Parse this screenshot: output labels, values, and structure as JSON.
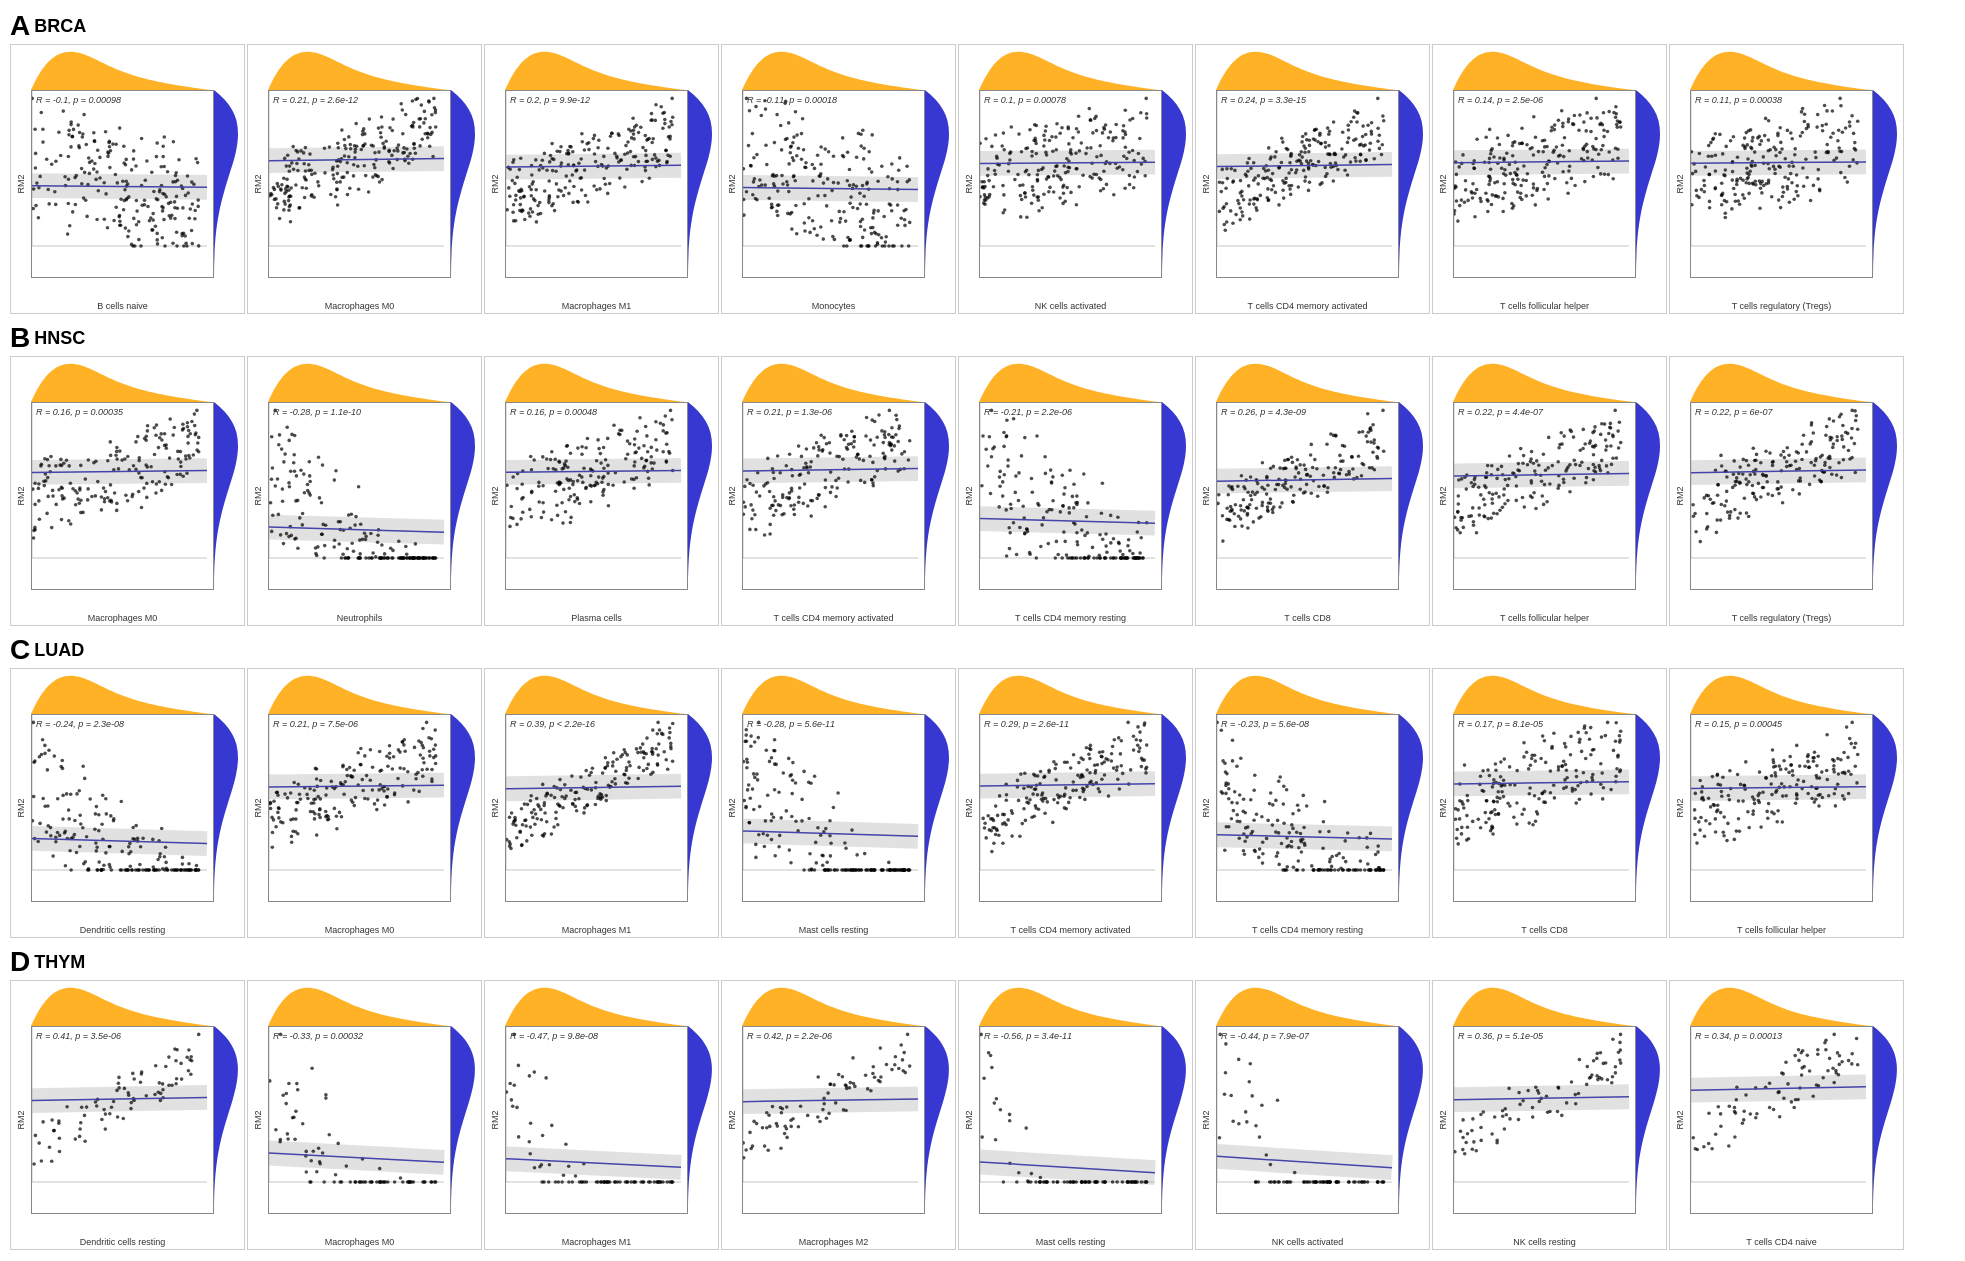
{
  "sections": [
    {
      "letter": "A",
      "title": "BRCA",
      "plots": [
        {
          "stat": "R = -0.1, p = 0.00098",
          "xlabel": "B cells naive",
          "slope": -0.1
        },
        {
          "stat": "R = 0.21, p = 2.6e-12",
          "xlabel": "Macrophages M0",
          "slope": 0.21
        },
        {
          "stat": "R = 0.2, p = 9.9e-12",
          "xlabel": "Macrophages M1",
          "slope": 0.2
        },
        {
          "stat": "R = -0.11, p = 0.00018",
          "xlabel": "Monocytes",
          "slope": -0.11
        },
        {
          "stat": "R = 0.1, p = 0.00078",
          "xlabel": "NK cells activated",
          "slope": 0.1
        },
        {
          "stat": "R = 0.24, p = 3.3e-15",
          "xlabel": "T cells CD4 memory activated",
          "slope": 0.24
        },
        {
          "stat": "R = 0.14, p = 2.5e-06",
          "xlabel": "T cells follicular helper",
          "slope": 0.14
        },
        {
          "stat": "R = 0.11, p = 0.00038",
          "xlabel": "T cells regulatory (Tregs)",
          "slope": 0.11
        }
      ]
    },
    {
      "letter": "B",
      "title": "HNSC",
      "plots": [
        {
          "stat": "R = 0.16, p = 0.00035",
          "xlabel": "Macrophages M0",
          "slope": 0.16
        },
        {
          "stat": "R = -0.28, p = 1.1e-10",
          "xlabel": "Neutrophils",
          "slope": -0.28
        },
        {
          "stat": "R = 0.16, p = 0.00048",
          "xlabel": "Plasma cells",
          "slope": 0.16
        },
        {
          "stat": "R = 0.21, p = 1.3e-06",
          "xlabel": "T cells CD4 memory activated",
          "slope": 0.21
        },
        {
          "stat": "R = -0.21, p = 2.2e-06",
          "xlabel": "T cells CD4 memory resting",
          "slope": -0.21
        },
        {
          "stat": "R = 0.26, p = 4.3e-09",
          "xlabel": "T cells CD8",
          "slope": 0.26
        },
        {
          "stat": "R = 0.22, p = 4.4e-07",
          "xlabel": "T cells follicular helper",
          "slope": 0.22
        },
        {
          "stat": "R = 0.22, p = 6e-07",
          "xlabel": "T cells regulatory (Tregs)",
          "slope": 0.22
        }
      ]
    },
    {
      "letter": "C",
      "title": "LUAD",
      "plots": [
        {
          "stat": "R = -0.24, p = 2.3e-08",
          "xlabel": "Dendritic cells resting",
          "slope": -0.24
        },
        {
          "stat": "R = 0.21, p = 7.5e-06",
          "xlabel": "Macrophages M0",
          "slope": 0.21
        },
        {
          "stat": "R = 0.39, p < 2.2e-16",
          "xlabel": "Macrophages M1",
          "slope": 0.39
        },
        {
          "stat": "R = -0.28, p = 5.6e-11",
          "xlabel": "Mast cells resting",
          "slope": -0.28
        },
        {
          "stat": "R = 0.29, p = 2.6e-11",
          "xlabel": "T cells CD4 memory activated",
          "slope": 0.29
        },
        {
          "stat": "R = -0.23, p = 5.6e-08",
          "xlabel": "T cells CD4 memory resting",
          "slope": -0.23
        },
        {
          "stat": "R = 0.17, p = 8.1e-05",
          "xlabel": "T cells CD8",
          "slope": 0.17
        },
        {
          "stat": "R = 0.15, p = 0.00045",
          "xlabel": "T cells follicular helper",
          "slope": 0.15
        }
      ]
    },
    {
      "letter": "D",
      "title": "THYM",
      "plots": [
        {
          "stat": "R = 0.41, p = 3.5e-06",
          "xlabel": "Dendritic cells resting",
          "slope": 0.41
        },
        {
          "stat": "R = -0.33, p = 0.00032",
          "xlabel": "Macrophages M0",
          "slope": -0.33
        },
        {
          "stat": "R = -0.47, p = 9.8e-08",
          "xlabel": "Macrophages M1",
          "slope": -0.47
        },
        {
          "stat": "R = 0.42, p = 2.2e-06",
          "xlabel": "Macrophages M2",
          "slope": 0.42
        },
        {
          "stat": "R = -0.56, p = 3.4e-11",
          "xlabel": "Mast cells resting",
          "slope": -0.56
        },
        {
          "stat": "R = -0.44, p = 7.9e-07",
          "xlabel": "NK cells activated",
          "slope": -0.44
        },
        {
          "stat": "R = 0.36, p = 5.1e-05",
          "xlabel": "NK cells resting",
          "slope": 0.36
        },
        {
          "stat": "R = 0.34, p = 0.00013",
          "xlabel": "T cells CD4 naive",
          "slope": 0.34
        }
      ]
    }
  ]
}
